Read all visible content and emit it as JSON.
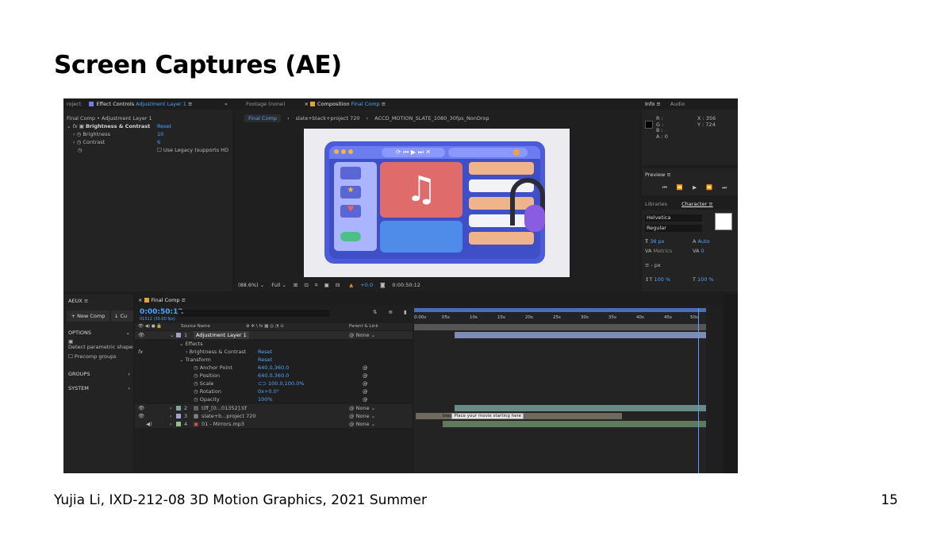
{
  "slide": {
    "title": "Screen Captures (AE)",
    "footer": "Yujia Li, IXD-212-08 3D Motion Graphics, 2021 Summer",
    "page_number": "15"
  },
  "effect_controls": {
    "tabs": [
      "roject",
      "Effect Controls",
      "Adjustment Layer 1"
    ],
    "breadcrumb": "Final Comp • Adjustment Layer 1",
    "effect_name": "Brightness & Contrast",
    "reset": "Reset",
    "brightness_label": "Brightness",
    "brightness_value": "10",
    "contrast_label": "Contrast",
    "contrast_value": "6",
    "legacy_label": "Use Legacy (supports HD"
  },
  "composition": {
    "footage_tab": "Footage (none)",
    "comp_tab": "Composition",
    "comp_name": "Final Comp",
    "crumbs": [
      "Final Comp",
      "slate+black+project 720",
      "ACCD_MOTION_SLATE_1080_30fps_NonDrop"
    ],
    "zoom": "(88.6%)",
    "resolution": "Full",
    "exposure": "+0.0",
    "timecode": "0:00:50:12"
  },
  "info_panel": {
    "tabs": [
      "Info",
      "Audio"
    ],
    "r": "R :",
    "g": "G :",
    "b": "B :",
    "a": "A : 0",
    "x": "X : 356",
    "y": "Y : 724"
  },
  "preview": {
    "title": "Preview"
  },
  "character": {
    "tabs": [
      "Libraries",
      "Character"
    ],
    "font": "Helvetica",
    "style": "Regular",
    "size": "36 px",
    "leading": "Auto",
    "kerning": "Metrics",
    "tracking": "0",
    "stroke": "- px",
    "vscale": "100 %",
    "hscale": "100 %"
  },
  "aeux": {
    "title": "AEUX",
    "new_comp": "New Comp",
    "options": "OPTIONS",
    "detect": "Detect parametric shapes",
    "precomp": "Precomp groups",
    "groups": "GROUPS",
    "system": "SYSTEM"
  },
  "timeline": {
    "tab": "Final Comp",
    "timecode": "0:00:50:12",
    "fps": "01512 (30.00 fps)",
    "col_source": "Source Name",
    "col_parent": "Parent & Link",
    "ruler": [
      "0:00s",
      "05s",
      "10s",
      "15s",
      "20s",
      "25s",
      "30s",
      "35s",
      "40s",
      "45s",
      "50s"
    ],
    "layers": [
      {
        "num": "1",
        "name": "Adjustment Layer 1",
        "parent": "None"
      },
      {
        "num": "2",
        "name": "tiff_[0...01352].tif",
        "parent": "None"
      },
      {
        "num": "3",
        "name": "slate+b...project 720",
        "parent": "None"
      },
      {
        "num": "4",
        "name": "01 - Mirrors.mp3",
        "parent": "None"
      }
    ],
    "props": [
      {
        "name": "Effects",
        "value": ""
      },
      {
        "name": "Brightness & Contrast",
        "value": "Reset"
      },
      {
        "name": "Transform",
        "value": "Reset"
      },
      {
        "name": "Anchor Point",
        "value": "640.0,360.0"
      },
      {
        "name": "Position",
        "value": "640.0,360.0"
      },
      {
        "name": "Scale",
        "value": "100.0,100.0%"
      },
      {
        "name": "Rotation",
        "value": "0x+0.0°"
      },
      {
        "name": "Opacity",
        "value": "100%"
      }
    ],
    "marker_text": "Place your movie starting here",
    "marker_prefix": "blac"
  },
  "colors": {
    "ae_blue": "#4ea3ff",
    "panel_bg": "#232323",
    "illus_frame": "#4b5bd9",
    "music_tile": "#e06b6b",
    "layer_bar": "#7e8bb6",
    "layer_bar2": "#6b7f6b"
  }
}
